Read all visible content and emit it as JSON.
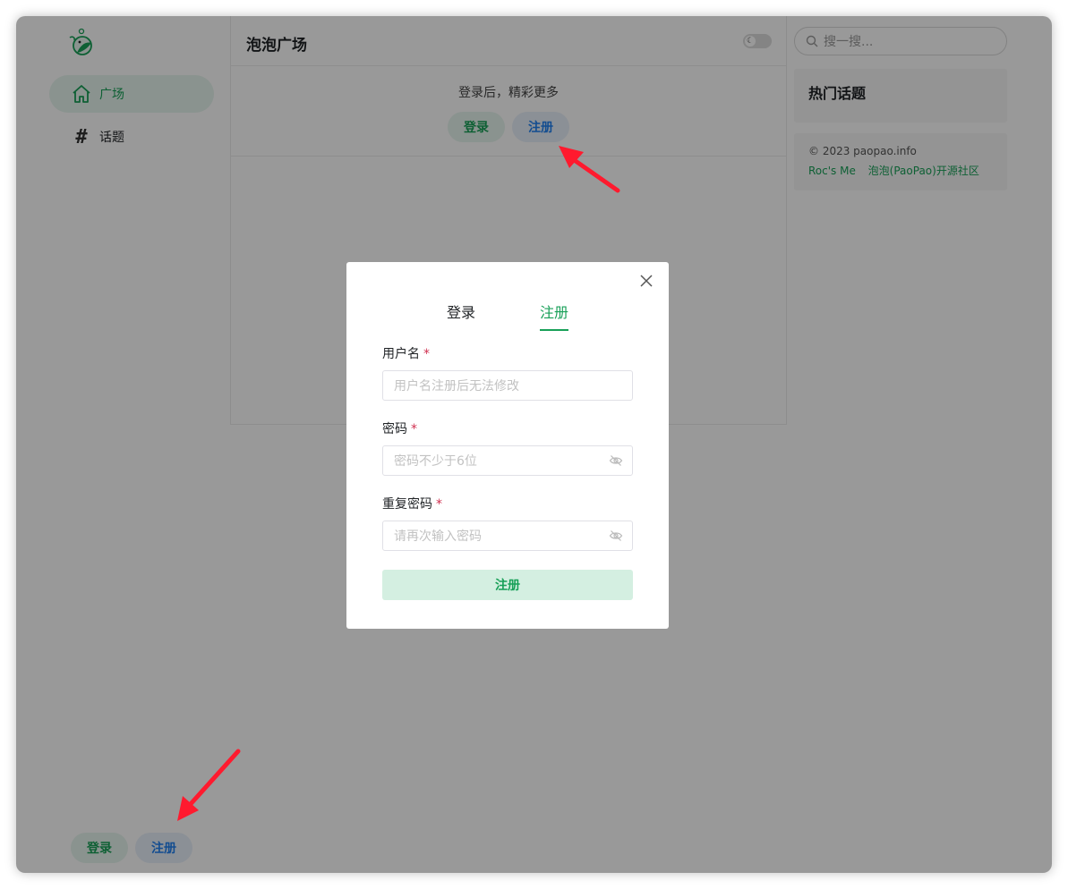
{
  "sidebar": {
    "items": [
      {
        "label": "广场",
        "icon": "home-icon",
        "active": true
      },
      {
        "label": "话题",
        "icon": "hash-icon",
        "active": false
      }
    ],
    "login_label": "登录",
    "register_label": "注册"
  },
  "main": {
    "title": "泡泡广场",
    "login_hint": "登录后，精彩更多",
    "login_label": "登录",
    "register_label": "注册"
  },
  "right": {
    "search_placeholder": "搜一搜...",
    "hot_topics_title": "热门话题",
    "copyright": "© 2023 paopao.info",
    "links": [
      "Roc's Me",
      "泡泡(PaoPao)开源社区"
    ]
  },
  "modal": {
    "tabs": [
      {
        "label": "登录",
        "active": false
      },
      {
        "label": "注册",
        "active": true
      }
    ],
    "fields": [
      {
        "label": "用户名",
        "required_mark": "*",
        "placeholder": "用户名注册后无法修改",
        "has_eye": false
      },
      {
        "label": "密码",
        "required_mark": "*",
        "placeholder": "密码不少于6位",
        "has_eye": true
      },
      {
        "label": "重复密码",
        "required_mark": "*",
        "placeholder": "请再次输入密码",
        "has_eye": true
      }
    ],
    "submit_label": "注册"
  },
  "colors": {
    "brand_green": "#18a058",
    "info_blue": "#2080f0",
    "required_red": "#d03050",
    "annotation_arrow": "#ff1a2e"
  }
}
